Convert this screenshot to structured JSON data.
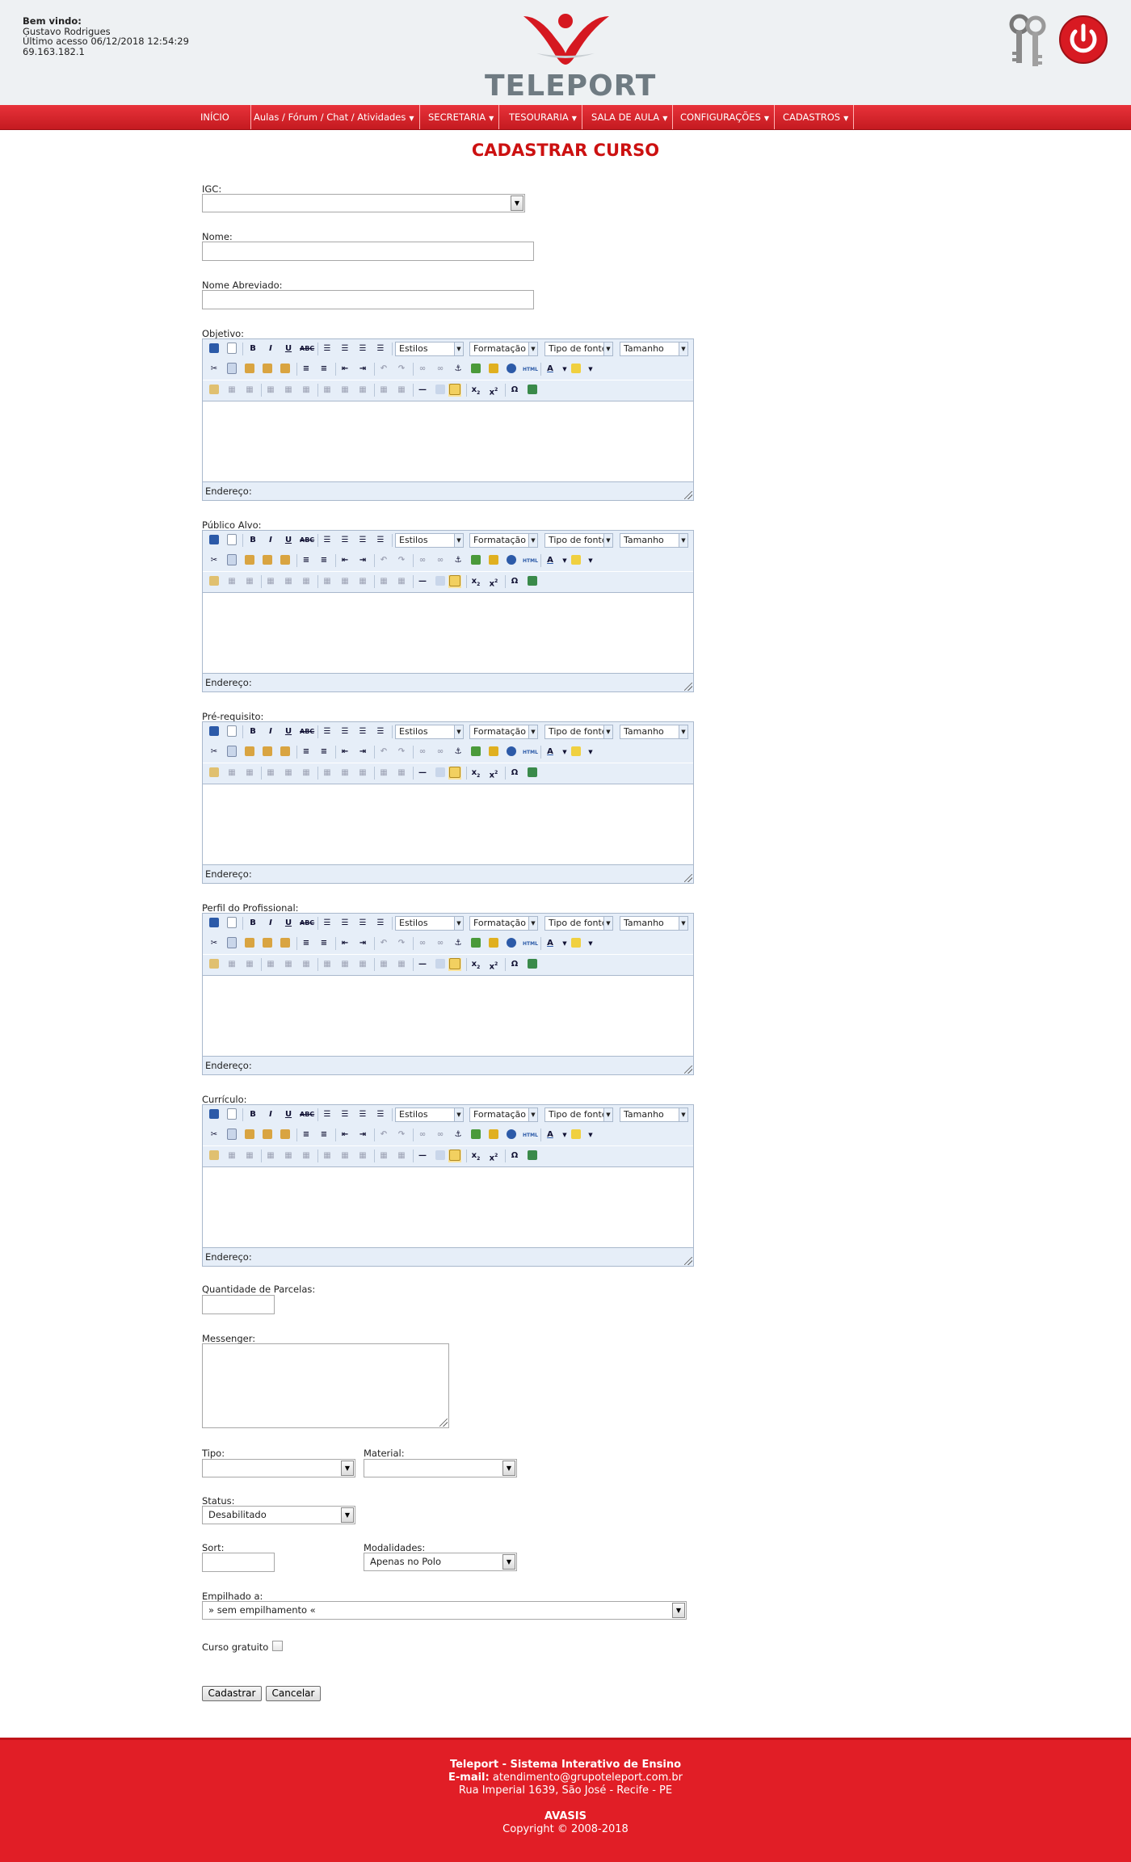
{
  "header": {
    "welcome_label": "Bem vindo:",
    "user_name": "Gustavo Rodrigues",
    "last_access": "Último acesso 06/12/2018 12:54:29",
    "ip": "69.163.182.1",
    "logo_text": "TELEPORT",
    "brand_color": "#e11e26"
  },
  "nav": {
    "items": [
      {
        "label": "INÍCIO",
        "has_dropdown": false
      },
      {
        "label": "Aulas / Fórum / Chat / Atividades",
        "has_dropdown": true
      },
      {
        "label": "SECRETARIA",
        "has_dropdown": true
      },
      {
        "label": "TESOURARIA",
        "has_dropdown": true
      },
      {
        "label": "SALA DE AULA",
        "has_dropdown": true
      },
      {
        "label": "CONFIGURAÇÕES",
        "has_dropdown": true
      },
      {
        "label": "CADASTROS",
        "has_dropdown": true
      }
    ]
  },
  "page": {
    "title": "CADASTRAR CURSO"
  },
  "form": {
    "igc_label": "IGC:",
    "igc_value": "",
    "nome_label": "Nome:",
    "nome_value": "",
    "nome_abrev_label": "Nome Abreviado:",
    "nome_abrev_value": "",
    "editors": [
      {
        "label": "Objetivo:"
      },
      {
        "label": "Público Alvo:"
      },
      {
        "label": "Pré-requisito:"
      },
      {
        "label": "Perfil do Profissional:"
      },
      {
        "label": "Currículo:"
      }
    ],
    "editor_toolbar": {
      "estilos": "Estilos",
      "formatacao": "Formatação",
      "tipo_fonte": "Tipo de fonte",
      "tamanho": "Tamanho",
      "status_label": "Endereço:"
    },
    "parcelas_label": "Quantidade de Parcelas:",
    "messenger_label": "Messenger:",
    "tipo_label": "Tipo:",
    "tipo_value": "",
    "material_label": "Material:",
    "material_value": "",
    "status_label": "Status:",
    "status_value": "Desabilitado",
    "sort_label": "Sort:",
    "modalidades_label": "Modalidades:",
    "modalidades_value": "Apenas no Polo",
    "empilhado_label": "Empilhado a:",
    "empilhado_value": "» sem empilhamento «",
    "gratuito_label": "Curso gratuito",
    "gratuito_checked": false,
    "submit_label": "Cadastrar",
    "cancel_label": "Cancelar"
  },
  "footer": {
    "line1": "Teleport - Sistema Interativo de Ensino",
    "email_label": "E-mail:",
    "email": "atendimento@grupoteleport.com.br",
    "address": "Rua Imperial 1639, São José - Recife - PE",
    "product": "AVASIS",
    "copyright": "Copyright © 2008-2018"
  }
}
